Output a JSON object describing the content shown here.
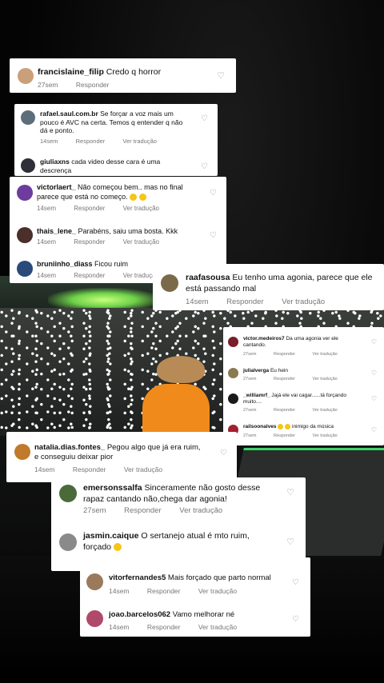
{
  "comments": [
    {
      "user": "francislaine_filip",
      "text": "Credo q horror",
      "time": "27sem",
      "reply": "Responder",
      "translate": ""
    },
    {
      "user": "rafael.saul.com.br",
      "text": "Se forçar a voz mais um pouco é AVC na certa. Temos q entender q não dá e ponto.",
      "time": "14sem",
      "reply": "Responder",
      "translate": "Ver tradução"
    },
    {
      "user": "giuliaxns",
      "text": "cada video desse cara é uma descrença",
      "time": "",
      "reply": "",
      "translate": ""
    },
    {
      "user": "victorlaert_",
      "text": "Não começou bem.. mas no final parece que está no começo.",
      "time": "14sem",
      "reply": "Responder",
      "translate": "Ver tradução"
    },
    {
      "user": "thais_lene_",
      "text": "Parabéns, saiu uma bosta. Kkk",
      "time": "14sem",
      "reply": "Responder",
      "translate": "Ver tradução"
    },
    {
      "user": "bruniinho_diass",
      "text": "Ficou ruim",
      "time": "14sem",
      "reply": "Responder",
      "translate": "Ver tradução"
    },
    {
      "user": "raafasousa",
      "text": "Eu tenho uma agonia, parece que ele está passando mal",
      "time": "14sem",
      "reply": "Responder",
      "translate": "Ver tradução"
    },
    {
      "user": "victor.medeiros7",
      "text": "Da uma agonia ver ele cantando.",
      "time": "27sem",
      "reply": "Responder",
      "translate": "Ver tradução"
    },
    {
      "user": "julialverga",
      "text": "Eu hein",
      "time": "27sem",
      "reply": "Responder",
      "translate": "Ver tradução"
    },
    {
      "user": "_williamrf_",
      "text": "Jajá ele vai cagar......tá forçando muito....",
      "time": "27sem",
      "reply": "Responder",
      "translate": "Ver tradução"
    },
    {
      "user": "railsoonalves",
      "text": "inimigo da música",
      "time": "27sem",
      "reply": "Responder",
      "translate": "Ver tradução"
    },
    {
      "user": "natalia.dias.fontes_",
      "text": "Pegou algo que já era ruim, e conseguiu deixar pior",
      "time": "14sem",
      "reply": "Responder",
      "translate": "Ver tradução"
    },
    {
      "user": "emersonssalfa",
      "text": "Sinceramente não gosto desse rapaz cantando não,chega dar agonia!",
      "time": "27sem",
      "reply": "Responder",
      "translate": "Ver tradução"
    },
    {
      "user": "jasmin.caique",
      "text": "O sertanejo atual é mto ruim, forçado",
      "time": "",
      "reply": "",
      "translate": ""
    },
    {
      "user": "vitorfernandes5",
      "text": "Mais forçado que parto normal",
      "time": "14sem",
      "reply": "Responder",
      "translate": "Ver tradução"
    },
    {
      "user": "joao.barcelos062",
      "text": "Vamo melhorar né",
      "time": "14sem",
      "reply": "Responder",
      "translate": "Ver tradução"
    }
  ],
  "icons": {
    "heart": "heart-outline-icon"
  },
  "colors": {
    "meta": "#777777",
    "stage_green": "#3fd36a",
    "shirt_orange": "#f08a1a"
  }
}
